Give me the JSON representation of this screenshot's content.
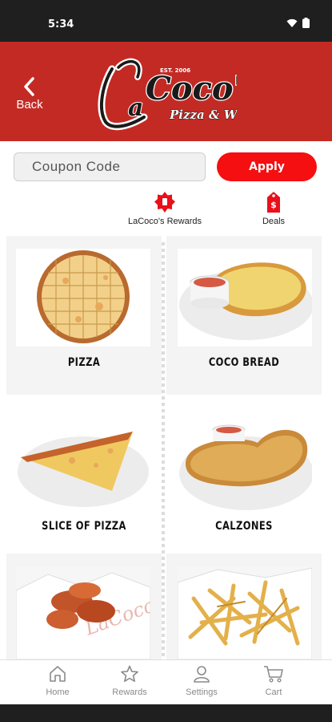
{
  "status_bar": {
    "time": "5:34"
  },
  "header": {
    "back_label": "Back",
    "brand_name": "LaCoco's",
    "brand_tagline": "Pizza & Wings",
    "brand_est": "Est. 2006"
  },
  "coupon": {
    "placeholder": "Coupon Code",
    "apply_label": "Apply"
  },
  "links": {
    "rewards_label": "LaCoco's Rewards",
    "deals_label": "Deals"
  },
  "menu": {
    "items": [
      {
        "label": "PIZZA"
      },
      {
        "label": "COCO BREAD"
      },
      {
        "label": "SLICE OF PIZZA"
      },
      {
        "label": "CALZONES"
      },
      {
        "label": ""
      },
      {
        "label": ""
      }
    ]
  },
  "bottom_nav": {
    "items": [
      {
        "label": "Home",
        "icon": "home-icon"
      },
      {
        "label": "Rewards",
        "icon": "star-icon"
      },
      {
        "label": "Settings",
        "icon": "person-icon"
      },
      {
        "label": "Cart",
        "icon": "cart-icon"
      }
    ]
  },
  "colors": {
    "header_red": "#c42a24",
    "apply_red": "#f50f10",
    "nav_gray": "#8a8a8a"
  }
}
